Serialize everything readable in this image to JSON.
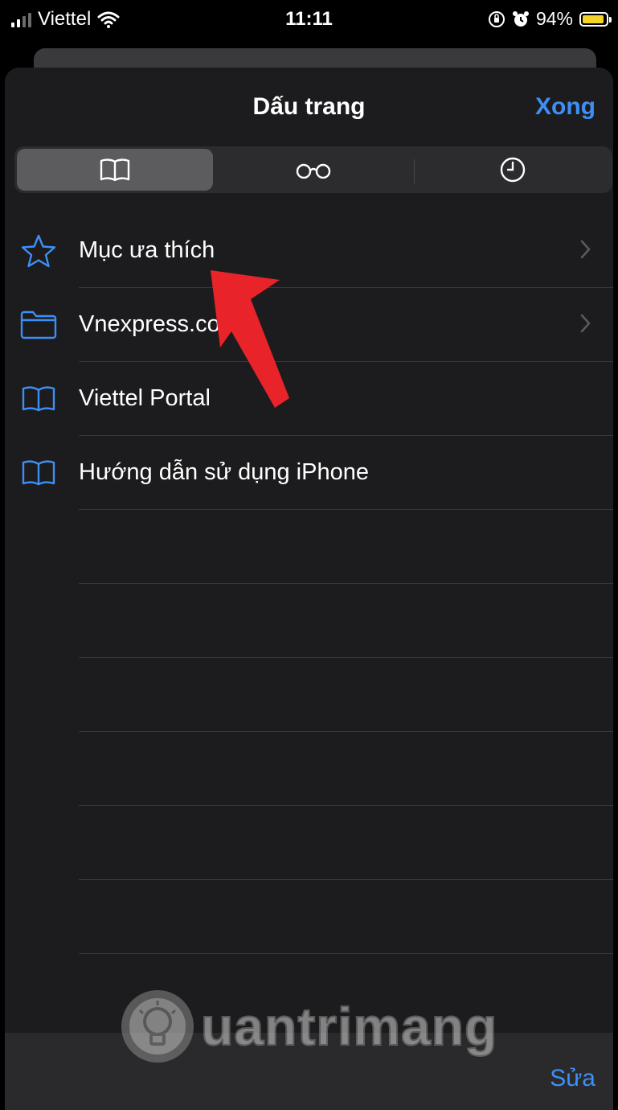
{
  "status_bar": {
    "carrier": "Viettel",
    "time": "11:11",
    "battery": "94%",
    "battery_level": 0.94
  },
  "sheet": {
    "title": "Dấu trang",
    "done_label": "Xong"
  },
  "segments": [
    {
      "icon": "book-icon",
      "selected": true
    },
    {
      "icon": "glasses-icon",
      "selected": false
    },
    {
      "icon": "clock-icon",
      "selected": false
    }
  ],
  "items": [
    {
      "label": "Mục ưa thích",
      "icon": "star-icon",
      "has_chevron": true
    },
    {
      "label": "Vnexpress.com",
      "icon": "folder-icon",
      "has_chevron": true
    },
    {
      "label": "Viettel Portal",
      "icon": "book-icon",
      "has_chevron": false
    },
    {
      "label": "Hướng dẫn sử dụng iPhone",
      "icon": "book-icon",
      "has_chevron": false
    }
  ],
  "toolbar": {
    "edit_label": "Sửa"
  },
  "watermark": {
    "text": "uantrimang"
  },
  "colors": {
    "accent": "#3e8ff5",
    "background": "#1c1c1e",
    "annotation": "#e8232a"
  }
}
